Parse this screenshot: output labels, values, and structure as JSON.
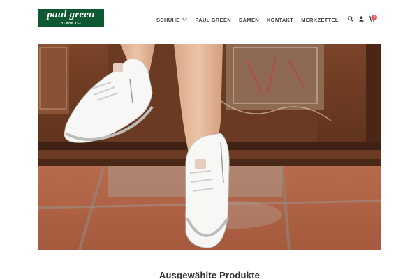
{
  "logo": {
    "brand": "paul green",
    "tagline": "ATMAN TCI"
  },
  "nav": {
    "items": [
      {
        "label": "SCHUHE",
        "has_dropdown": true
      },
      {
        "label": "PAUL GREEN",
        "has_dropdown": false
      },
      {
        "label": "DAMEN",
        "has_dropdown": false
      },
      {
        "label": "KONTAKT",
        "has_dropdown": false
      },
      {
        "label": "MERKZETTEL",
        "has_dropdown": false
      }
    ]
  },
  "header_icons": {
    "search": "search-icon",
    "account": "user-icon",
    "cart": "cart-icon",
    "cart_count": "0"
  },
  "hero": {
    "image": "white-sneakers-on-terracotta-floor"
  },
  "sections": {
    "featured_title": "Ausgewählte Produkte"
  },
  "colors": {
    "brand_green": "#0d5a32",
    "badge": "#e05a5a",
    "nav_text": "#444444"
  }
}
